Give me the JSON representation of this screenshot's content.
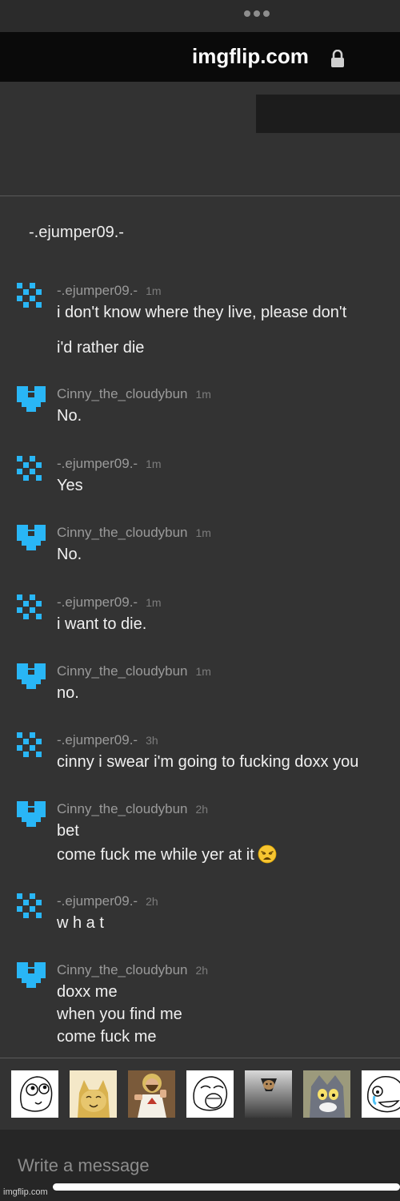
{
  "browser": {
    "url": "imgflip.com"
  },
  "chat": {
    "title": "-.ejumper09.-"
  },
  "messages": [
    {
      "user": "-.ejumper09.-",
      "time": "1m",
      "avatar": "pixel-x-avatar",
      "lines": [
        "i don't know where they live, please don't",
        "i'd rather die"
      ]
    },
    {
      "user": "Cinny_the_cloudybun",
      "time": "1m",
      "avatar": "pixel-heart-avatar",
      "lines": [
        "No."
      ]
    },
    {
      "user": "-.ejumper09.-",
      "time": "1m",
      "avatar": "pixel-x-avatar",
      "lines": [
        "Yes"
      ]
    },
    {
      "user": "Cinny_the_cloudybun",
      "time": "1m",
      "avatar": "pixel-heart-avatar",
      "lines": [
        "No."
      ]
    },
    {
      "user": "-.ejumper09.-",
      "time": "1m",
      "avatar": "pixel-x-avatar",
      "lines": [
        "i want to die."
      ]
    },
    {
      "user": "Cinny_the_cloudybun",
      "time": "1m",
      "avatar": "pixel-heart-avatar",
      "lines": [
        "no."
      ]
    },
    {
      "user": "-.ejumper09.-",
      "time": "3h",
      "avatar": "pixel-x-avatar",
      "lines": [
        "cinny i swear i'm going to fucking doxx you"
      ]
    },
    {
      "user": "Cinny_the_cloudybun",
      "time": "2h",
      "avatar": "pixel-heart-avatar",
      "lines": [
        "bet",
        "come fuck me while yer at it"
      ],
      "emoji": "weary-face-emoji"
    },
    {
      "user": "-.ejumper09.-",
      "time": "2h",
      "avatar": "pixel-x-avatar",
      "lines": [
        "w h a t"
      ]
    },
    {
      "user": "Cinny_the_cloudybun",
      "time": "2h",
      "avatar": "pixel-heart-avatar",
      "lines": [
        "doxx me",
        "when you find me",
        "come fuck me"
      ]
    }
  ],
  "meme_picker": [
    "derp-face-meme",
    "smiling-cat-meme",
    "buddy-christ-meme",
    "lol-rage-face-meme",
    "ceiling-cat-meme",
    "unsettled-tom-meme",
    "happy-cry-face-meme"
  ],
  "composer": {
    "placeholder": "Write a message"
  },
  "watermark": "imgflip.com",
  "colors": {
    "accent": "#29b6f6",
    "background": "#333333",
    "urlbar": "#0a0a0a"
  }
}
